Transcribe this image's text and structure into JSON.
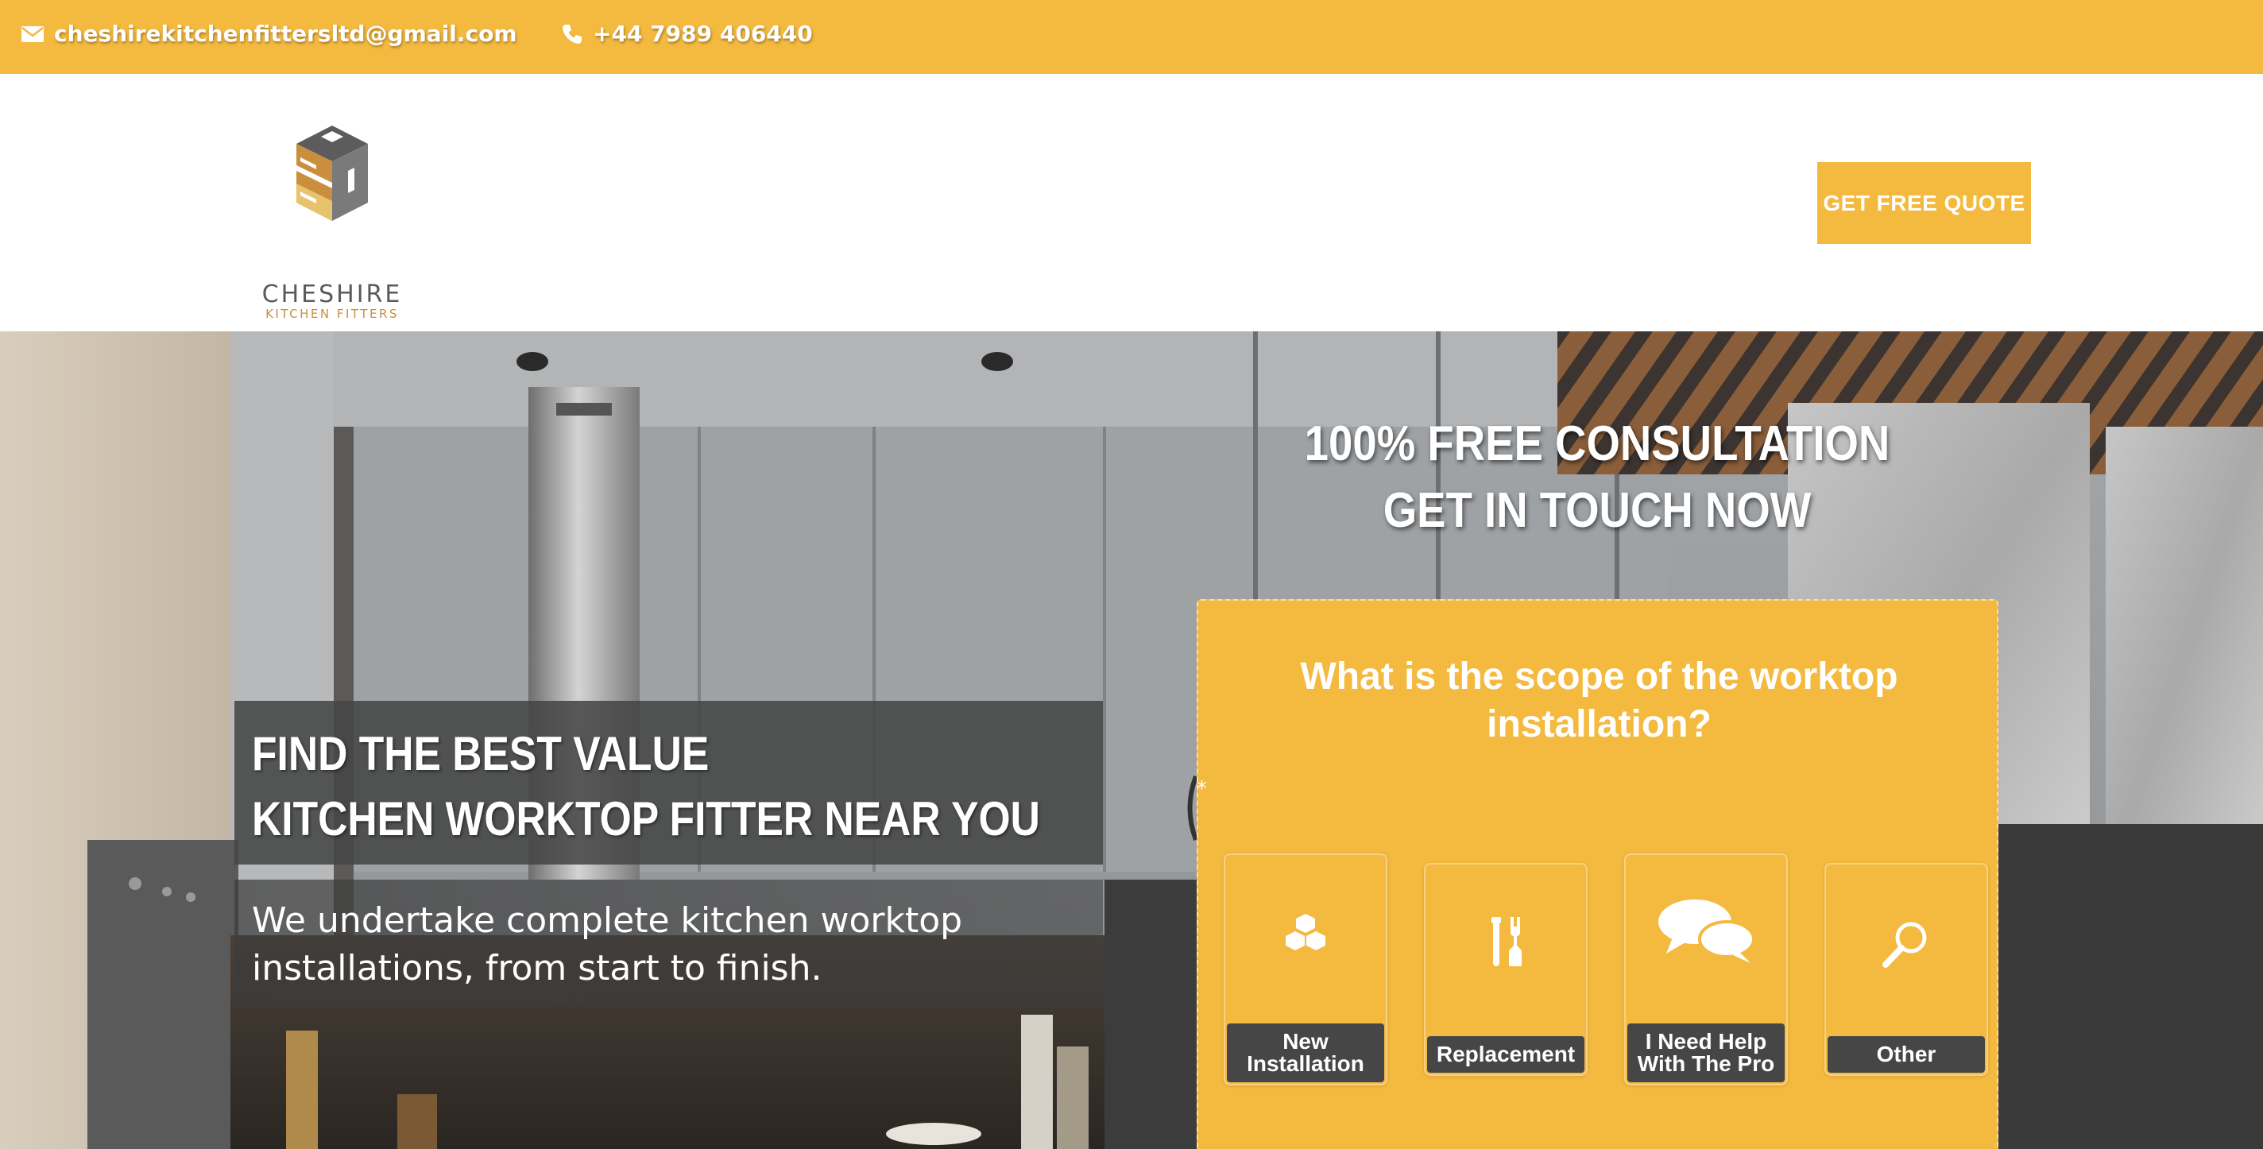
{
  "topbar": {
    "email": "cheshirekitchenfittersltd@gmail.com",
    "phone": "+44 7989 406440",
    "icons": [
      "envelope-icon",
      "phone-icon"
    ]
  },
  "header": {
    "logo": {
      "name": "CHESHIRE",
      "sub": "KITCHEN FITTERS"
    },
    "quote_button": "GET FREE QUOTE"
  },
  "hero": {
    "cta_line1": "100% FREE CONSULTATION",
    "cta_line2": "GET IN TOUCH NOW",
    "headline_line1": "FIND THE BEST VALUE",
    "headline_line2": "KITCHEN WORKTOP FITTER NEAR YOU",
    "subline": "We undertake complete kitchen worktop installations, from start to finish."
  },
  "quiz": {
    "question": "What is the scope of the worktop installation?",
    "required_mark": "*",
    "options": [
      {
        "label": "New Installation",
        "icon": "boxes-icon"
      },
      {
        "label": "Replacement",
        "icon": "tools-icon"
      },
      {
        "label": "I Need Help With The Pro",
        "icon": "speech-bubbles-icon"
      },
      {
        "label": "Other",
        "icon": "magnifier-icon"
      }
    ]
  },
  "colors": {
    "accent": "#f4b93f",
    "dark": "#464646",
    "white": "#ffffff",
    "logo_brown": "#c98f3c"
  }
}
